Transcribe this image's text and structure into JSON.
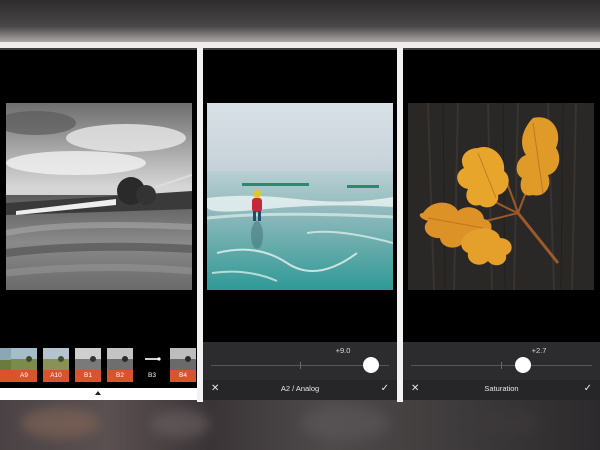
{
  "panels": {
    "filter_panel": {
      "filters": [
        {
          "label": "",
          "selected": false
        },
        {
          "label": "A9",
          "selected": false
        },
        {
          "label": "A10",
          "selected": false
        },
        {
          "label": "B1",
          "selected": false
        },
        {
          "label": "B2",
          "selected": false
        },
        {
          "label": "B3",
          "selected": true
        },
        {
          "label": "B4",
          "selected": false
        }
      ]
    },
    "analog_panel": {
      "slider_value": "+9.0",
      "slider_level": 0.9,
      "tool_name": "A2 / Analog",
      "cancel_icon": "close-icon",
      "confirm_icon": "checkmark-icon"
    },
    "saturation_panel": {
      "slider_value": "+2.7",
      "slider_level": 0.62,
      "tool_name": "Saturation",
      "cancel_icon": "close-icon",
      "confirm_icon": "checkmark-icon"
    }
  },
  "colors": {
    "filter_label_bg": "#d9532d",
    "panel_bg": "#000000",
    "slider_bg": "#2c2c2e"
  }
}
